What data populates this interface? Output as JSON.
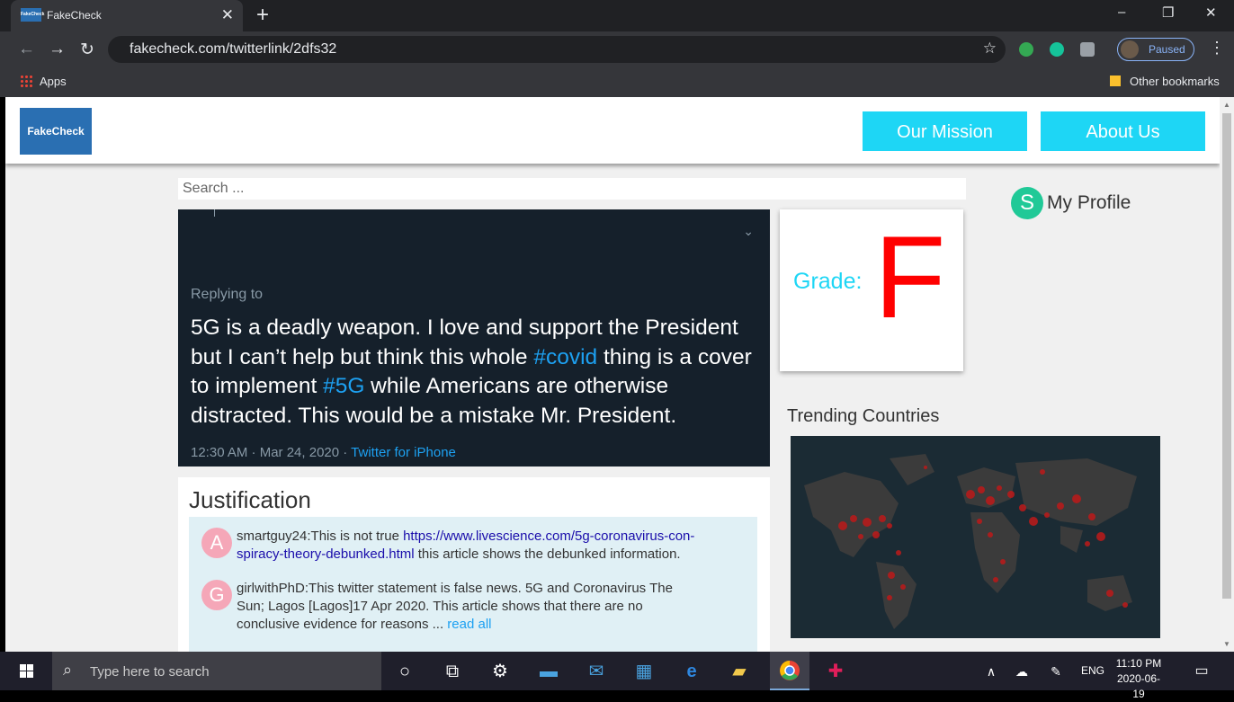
{
  "browser": {
    "tab_title": "FakeCheck",
    "tab_favicon_text": "FakeCheck",
    "url": "fakecheck.com/twitterlink/2dfs32",
    "profile_status": "Paused",
    "bookmarks": {
      "apps_label": "Apps",
      "other_label": "Other bookmarks"
    }
  },
  "site": {
    "logo_text": "FakeCheck",
    "nav": [
      {
        "label": "Our Mission"
      },
      {
        "label": "About Us"
      }
    ],
    "search_placeholder": "Search ...",
    "profile": {
      "initial": "S",
      "label": "My Profile"
    }
  },
  "tweet": {
    "replying_to": "Replying to",
    "text_parts": [
      "5G is a deadly weapon. I love and support the President but I can’t help but think this whole ",
      "#covid",
      " thing is a cover to implement ",
      "#5G",
      " while Americans are otherwise distracted. This would be a mistake Mr. President."
    ],
    "timestamp": "12:30 AM · Mar 24, 2020 · ",
    "source": "Twitter for iPhone"
  },
  "grade": {
    "label": "Grade:",
    "value": "F"
  },
  "trending": {
    "title": "Trending Countries"
  },
  "justification": {
    "title": "Justification",
    "comments": [
      {
        "initial": "A",
        "user": "smartguy24:",
        "text_before": "This is not true ",
        "link": "https://www.livescience.com/5g-coronavirus-con-spiracy-theory-debunked.html",
        "text_after": " this article shows the debunked information."
      },
      {
        "initial": "G",
        "user": "girlwithPhD:",
        "text": "This twitter statement is false news. 5G and Coronavirus The Sun; Lagos [Lagos]17 Apr 2020. This article shows that there are no conclusive evidence for reasons ... ",
        "read_all": "read all"
      }
    ]
  },
  "taskbar": {
    "search_placeholder": "Type here to search",
    "language": "ENG",
    "time": "11:10 PM",
    "date": "2020-06-19"
  },
  "colors": {
    "accent": "#1ed6f5",
    "grade": "#ff0000",
    "tweet_bg": "#15202b",
    "logo_bg": "#2a6fb2"
  }
}
